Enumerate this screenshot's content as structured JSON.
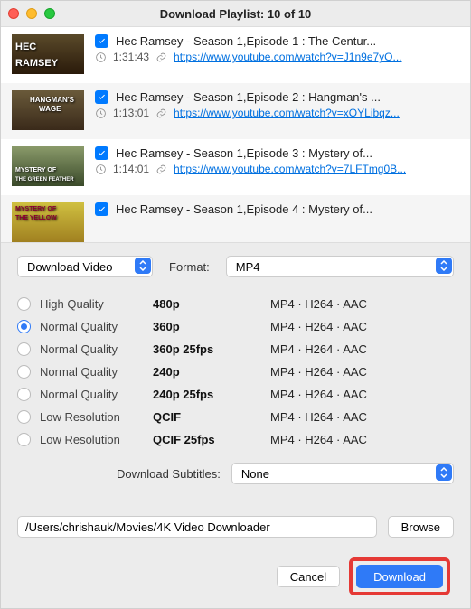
{
  "window": {
    "title": "Download Playlist: 10 of 10"
  },
  "playlist": [
    {
      "title": "Hec Ramsey - Season 1,Episode 1 : The Centur...",
      "duration": "1:31:43",
      "url": "https://www.youtube.com/watch?v=J1n9e7yO...",
      "thumb_top": "HEC",
      "thumb_bottom": "RAMSEY",
      "bg": "1"
    },
    {
      "title": "Hec Ramsey - Season 1,Episode 2 : Hangman's ...",
      "duration": "1:13:01",
      "url": "https://www.youtube.com/watch?v=xOYLibqz...",
      "thumb_top": "HANGMAN'S",
      "thumb_bottom": "WAGE",
      "bg": "2"
    },
    {
      "title": "Hec Ramsey - Season 1,Episode 3 : Mystery of...",
      "duration": "1:14:01",
      "url": "https://www.youtube.com/watch?v=7LFTmg0B...",
      "thumb_top": "MYSTERY OF",
      "thumb_bottom": "THE GREEN FEATHER",
      "bg": "3"
    },
    {
      "title": "Hec Ramsey - Season 1,Episode 4 : Mystery of...",
      "duration": "",
      "url": "",
      "thumb_top": "MYSTERY OF",
      "thumb_bottom": "THE YELLOW",
      "bg": "4"
    }
  ],
  "action_select": "Download Video",
  "format_label": "Format:",
  "format_value": "MP4",
  "qualities": [
    {
      "name": "High Quality",
      "res": "480p",
      "codec": "MP4 · H264 · AAC",
      "selected": false
    },
    {
      "name": "Normal Quality",
      "res": "360p",
      "codec": "MP4 · H264 · AAC",
      "selected": true
    },
    {
      "name": "Normal Quality",
      "res": "360p 25fps",
      "codec": "MP4 · H264 · AAC",
      "selected": false
    },
    {
      "name": "Normal Quality",
      "res": "240p",
      "codec": "MP4 · H264 · AAC",
      "selected": false
    },
    {
      "name": "Normal Quality",
      "res": "240p 25fps",
      "codec": "MP4 · H264 · AAC",
      "selected": false
    },
    {
      "name": "Low Resolution",
      "res": "QCIF",
      "codec": "MP4 · H264 · AAC",
      "selected": false
    },
    {
      "name": "Low Resolution",
      "res": "QCIF 25fps",
      "codec": "MP4 · H264 · AAC",
      "selected": false
    }
  ],
  "subtitle_label": "Download Subtitles:",
  "subtitle_value": "None",
  "path": "/Users/chrishauk/Movies/4K Video Downloader",
  "browse_label": "Browse",
  "cancel_label": "Cancel",
  "download_label": "Download"
}
